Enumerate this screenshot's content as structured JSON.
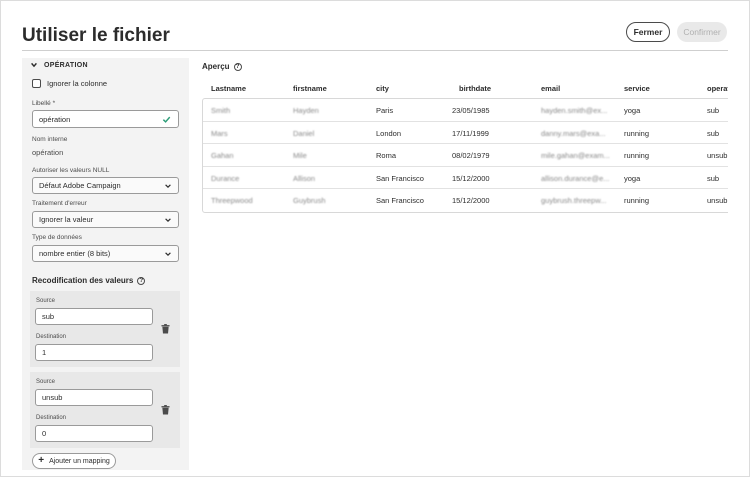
{
  "dialog": {
    "title": "Utiliser le fichier",
    "close_label": "Fermer",
    "confirm_label": "Confirmer"
  },
  "operation_panel": {
    "section_label": "OPÉRATION",
    "ignore_column_label": "Ignorer la colonne",
    "libelle_label": "Libellé *",
    "libelle_value": "opération",
    "nom_interne_label": "Nom interne",
    "nom_interne_value": "opération",
    "null_label": "Autoriser les valeurs NULL",
    "null_value": "Défaut Adobe Campaign",
    "error_label": "Traitement d'erreur",
    "error_value": "Ignorer la valeur",
    "type_label": "Type de données",
    "type_value": "nombre entier (8 bits)",
    "recod_title": "Recodification des valeurs",
    "mappings": [
      {
        "source_label": "Source",
        "source": "sub",
        "dest_label": "Destination",
        "destination": "1"
      },
      {
        "source_label": "Source",
        "source": "unsub",
        "dest_label": "Destination",
        "destination": "0"
      }
    ],
    "add_mapping_label": "Ajouter un mapping"
  },
  "preview": {
    "title": "Aperçu",
    "columns": [
      "Lastname",
      "firstname",
      "city",
      "birthdate",
      "email",
      "service",
      "operation"
    ],
    "rows": [
      [
        "Smith",
        "Hayden",
        "Paris",
        "23/05/1985",
        "hayden.smith@ex...",
        "yoga",
        "sub"
      ],
      [
        "Mars",
        "Daniel",
        "London",
        "17/11/1999",
        "danny.mars@exa...",
        "running",
        "sub"
      ],
      [
        "Gahan",
        "Mile",
        "Roma",
        "08/02/1979",
        "mile.gahan@exam...",
        "running",
        "unsub"
      ],
      [
        "Durance",
        "Allison",
        "San Francisco",
        "15/12/2000",
        "allison.durance@e...",
        "yoga",
        "sub"
      ],
      [
        "Threepwood",
        "Guybrush",
        "San Francisco",
        "15/12/2000",
        "guybrush.threepw...",
        "running",
        "unsub"
      ]
    ]
  },
  "colors": {
    "accent_check": "#2d9d78",
    "panel_bg": "#f3f3f3"
  }
}
